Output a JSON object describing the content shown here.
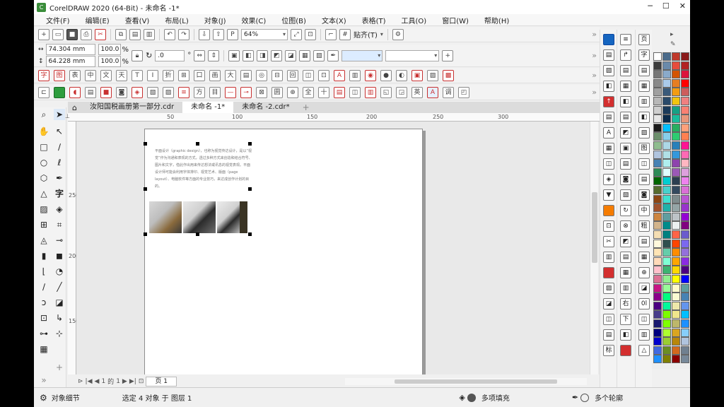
{
  "app": {
    "title": "CorelDRAW 2020 (64-Bit) - 未命名 -1*"
  },
  "menu": [
    "文件(F)",
    "编辑(E)",
    "查看(V)",
    "布局(L)",
    "对象(J)",
    "效果(C)",
    "位图(B)",
    "文本(X)",
    "表格(T)",
    "工具(O)",
    "窗口(W)",
    "帮助(H)"
  ],
  "toolbar": {
    "zoom": "64%",
    "snap_label": "贴齐(T)"
  },
  "property_bar": {
    "width": "74.304 mm",
    "height": "64.228 mm",
    "scale_x": "100.0",
    "scale_y": "100.0",
    "percent": "%",
    "rotation": ".0",
    "degree": "°"
  },
  "document_tabs": [
    "汝阳国税画册第一部分.cdr",
    "未命名 -1*",
    "未命名 -2.cdr*"
  ],
  "ruler_h": [
    "50",
    "100",
    "150",
    "200",
    "250",
    "300"
  ],
  "ruler_v": [
    "250",
    "200",
    "150"
  ],
  "page": {
    "paragraph": "平面设计（graphic design），也称为视觉传达设计，是以“视觉”作为沟通和表现的方式，透过多种方式来创造和结合符号、图片和文字，借此作出用来传达想法或讯息的视觉表现。平面设计师可能会利用字体排印、视觉艺术、版面（page layout）、电脑软件等方面的专业技巧，来达成创作计划的目的。"
  },
  "page_nav": {
    "current": "1",
    "of": "的",
    "total": "1",
    "page_tab": "页 1"
  },
  "status": {
    "object_details": "对象细节",
    "selection": "选定 4 对象 于 图层 1",
    "fill": "多项填充",
    "outline": "多个轮廓"
  },
  "icons": [
    "search-icon",
    "hand-icon",
    "rectangle-icon",
    "ellipse-icon",
    "polygon-icon",
    "text-icon",
    "pen-icon",
    "eyedropper-icon"
  ],
  "palette_colors": [
    "#ffffff",
    "#000000",
    "#e53935",
    "#fbc02d",
    "#43a047",
    "#1e88e5",
    "#8e24aa",
    "#00897b",
    "#f57c00",
    "#6d4c41",
    "#546e7a",
    "#c2185b"
  ]
}
